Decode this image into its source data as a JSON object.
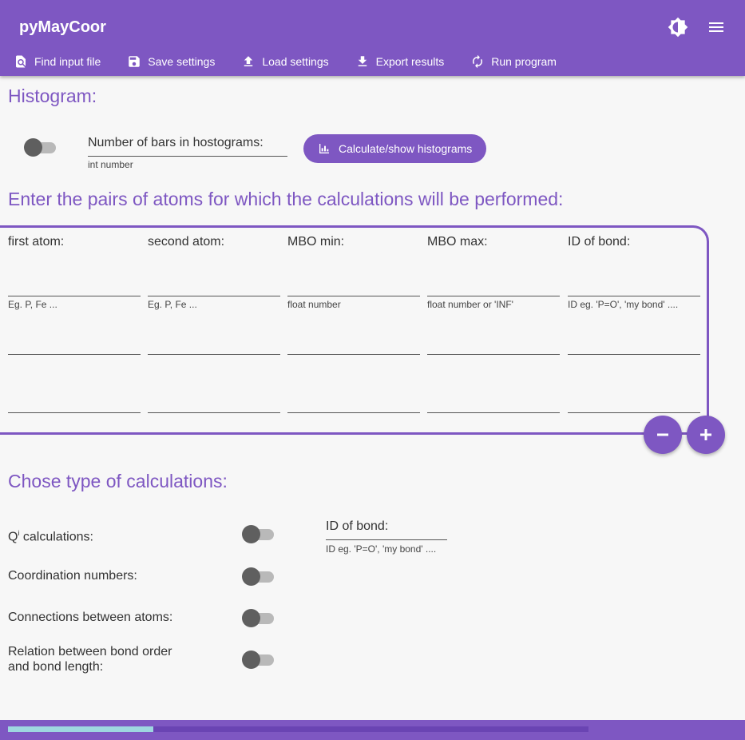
{
  "app": {
    "title": "pyMayCoor"
  },
  "icons": {
    "theme": "brightness-icon",
    "menu": "hamburger-menu-icon"
  },
  "toolbar": {
    "find_input": "Find input file",
    "save_settings": "Save settings",
    "load_settings": "Load settings",
    "export_results": "Export results",
    "run_program": "Run program"
  },
  "histogram": {
    "heading": "Histogram:",
    "bars_label": "Number of bars in hostograms:",
    "bars_hint": "int number",
    "bars_value": "",
    "button": "Calculate/show histograms",
    "toggle_on": false
  },
  "pairs": {
    "heading": "Enter the pairs of atoms for which the calculations will be performed:",
    "columns": [
      "first atom:",
      "second atom:",
      "MBO min:",
      "MBO max:",
      "ID of bond:"
    ],
    "hints": [
      "Eg. P, Fe ...",
      "Eg. P, Fe ...",
      "float number",
      "float number or 'INF'",
      "ID eg. 'P=O', 'my bond' ...."
    ],
    "rows": [
      [
        "",
        "",
        "",
        "",
        ""
      ],
      [
        "",
        "",
        "",
        "",
        ""
      ],
      [
        "",
        "",
        "",
        "",
        ""
      ]
    ]
  },
  "calculations": {
    "heading": "Chose type of calculations:",
    "qi_label": "Q",
    "qi_sup": "i",
    "qi_suffix": " calculations:",
    "coordination": "Coordination numbers:",
    "connections": "Connections between atoms:",
    "relation_line1": "Relation between bond order",
    "relation_line2": "and bond length:",
    "id_label": "ID of bond:",
    "id_hint": "ID eg. 'P=O', 'my bond' ....",
    "id_value": ""
  },
  "progress": {
    "value": 0.25
  },
  "colors": {
    "primary": "#7e57c2",
    "progress_fill": "#9ed6e0"
  }
}
